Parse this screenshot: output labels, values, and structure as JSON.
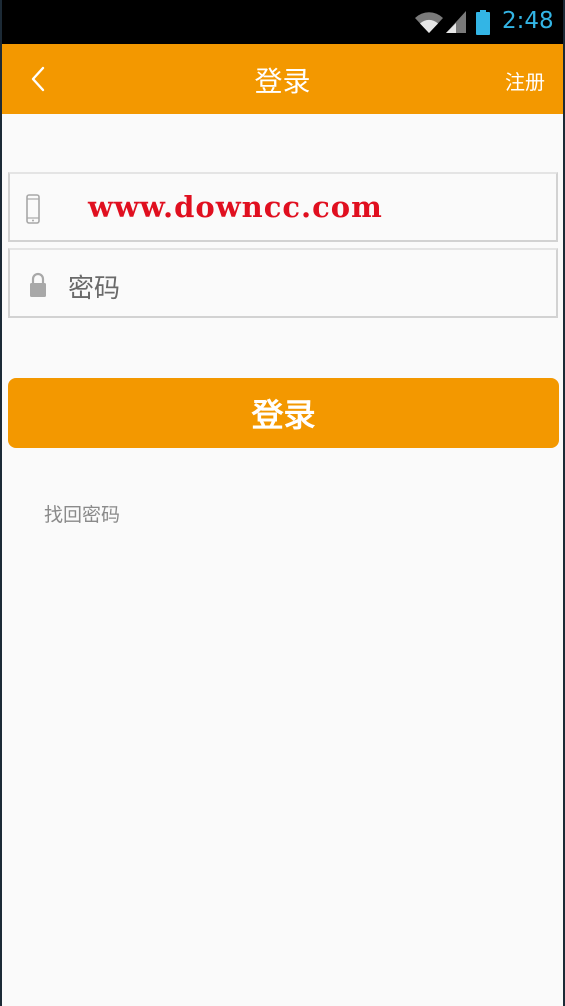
{
  "status_bar": {
    "time": "2:48"
  },
  "app_bar": {
    "title": "登录",
    "register_label": "注册"
  },
  "form": {
    "phone_value": "www.downcc.com",
    "password_placeholder": "密码",
    "login_label": "登录",
    "forgot_label": "找回密码"
  },
  "colors": {
    "accent": "#f39800",
    "status_text": "#33b5e5",
    "watermark": "#e00f1f"
  },
  "icons": [
    "back-chevron-icon",
    "phone-icon",
    "lock-icon",
    "wifi-icon",
    "signal-icon",
    "battery-icon"
  ]
}
